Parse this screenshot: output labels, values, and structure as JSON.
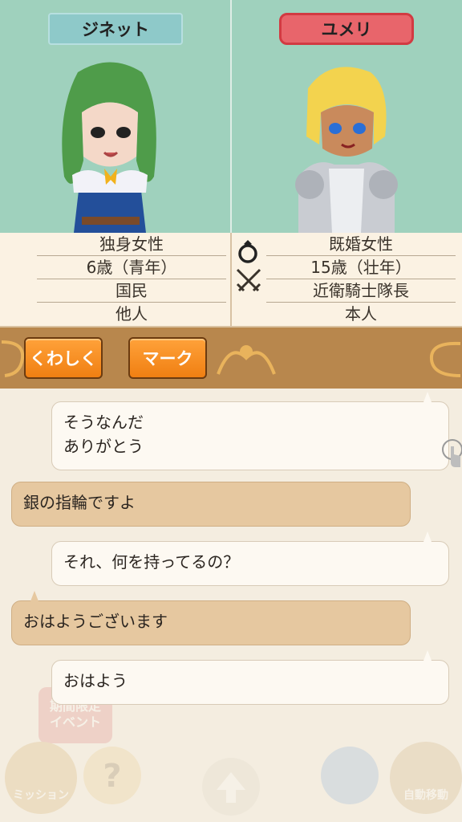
{
  "characters": {
    "left": {
      "name": "ジネット",
      "info": [
        "独身女性",
        "6歳（青年）",
        "国民",
        "他人"
      ]
    },
    "right": {
      "name": "ユメリ",
      "info": [
        "既婚女性",
        "15歳（壮年）",
        "近衛騎士隊長",
        "本人"
      ]
    }
  },
  "buttons": {
    "detail": "くわしく",
    "mark": "マーク"
  },
  "chat": [
    {
      "side": "right",
      "lines": [
        "そうなんだ",
        "ありがとう"
      ]
    },
    {
      "side": "left",
      "lines": [
        "銀の指輪ですよ"
      ]
    },
    {
      "side": "right",
      "lines": [
        "それ、何を持ってるの？"
      ]
    },
    {
      "side": "left",
      "lines": [
        "おはようございます"
      ]
    },
    {
      "side": "right",
      "lines": [
        "おはよう"
      ]
    }
  ],
  "background_labels": {
    "event": "期間限定\nイベント",
    "mission": "ミッション",
    "auto_move": "自動移動"
  },
  "colors": {
    "portrait_bg": "#9fd1bd",
    "left_tag": "#8ec9c9",
    "right_tag": "#e8656b",
    "button": "#f58a1f",
    "bar": "#b8874d",
    "bubble_left": "#e6c8a0",
    "bubble_right": "#fdf9f2"
  },
  "icons": {
    "married": "ring-icon",
    "occupation": "crossed-swords-icon",
    "touch": "tap-hand-icon",
    "help": "question-icon",
    "up": "arrow-up-icon"
  }
}
